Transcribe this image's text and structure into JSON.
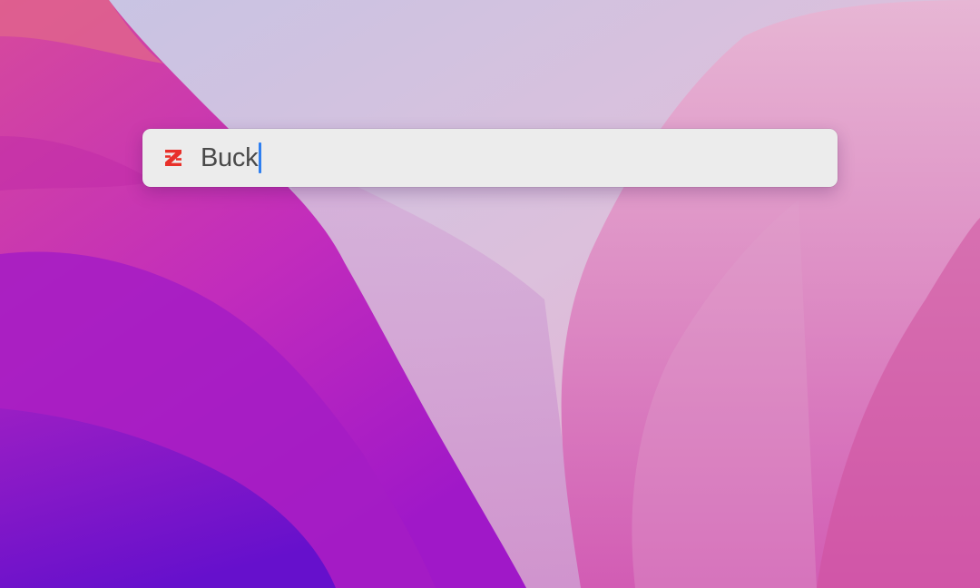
{
  "search": {
    "query": "Buck",
    "app_icon": "zotero-z-icon"
  },
  "colors": {
    "accent_caret": "#2f7ff0",
    "icon_red": "#e8302a",
    "bar_background": "#ececec"
  }
}
